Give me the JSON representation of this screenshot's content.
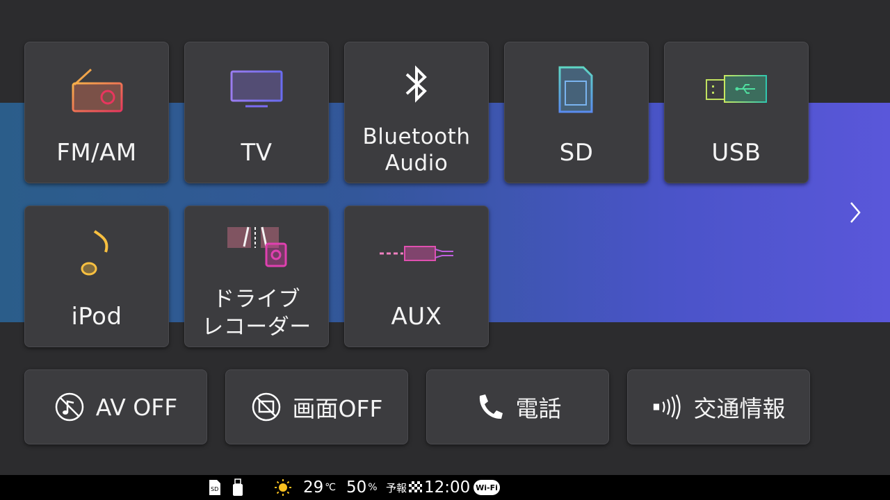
{
  "sources": [
    {
      "label": "FM/AM",
      "icon": "radio-icon"
    },
    {
      "label": "TV",
      "icon": "tv-icon"
    },
    {
      "label_line1": "Bluetooth",
      "label_line2": "Audio",
      "icon": "bluetooth-icon"
    },
    {
      "label": "SD",
      "icon": "sd-card-icon"
    },
    {
      "label": "USB",
      "icon": "usb-icon"
    },
    {
      "label": "iPod",
      "icon": "music-note-icon"
    },
    {
      "label_line1": "ドライブ",
      "label_line2": "レコーダー",
      "icon": "dashcam-icon"
    },
    {
      "label": "AUX",
      "icon": "aux-cable-icon"
    }
  ],
  "actions": [
    {
      "label": "AV OFF",
      "icon": "music-off-icon"
    },
    {
      "label": "画面OFF",
      "icon": "screen-off-icon"
    },
    {
      "label": "電話",
      "icon": "phone-icon"
    },
    {
      "label": "交通情報",
      "icon": "traffic-broadcast-icon"
    }
  ],
  "status_bar": {
    "temperature": "29",
    "temperature_unit": "℃",
    "humidity": "50",
    "humidity_unit": "%",
    "forecast_label": "予報",
    "time": "12:00",
    "wifi": "Wi-Fi"
  },
  "colors": {
    "background": "#2c2c2e",
    "tile": "#3c3c3f",
    "band_start": "#2b5d8a",
    "band_end": "#5a57da"
  }
}
